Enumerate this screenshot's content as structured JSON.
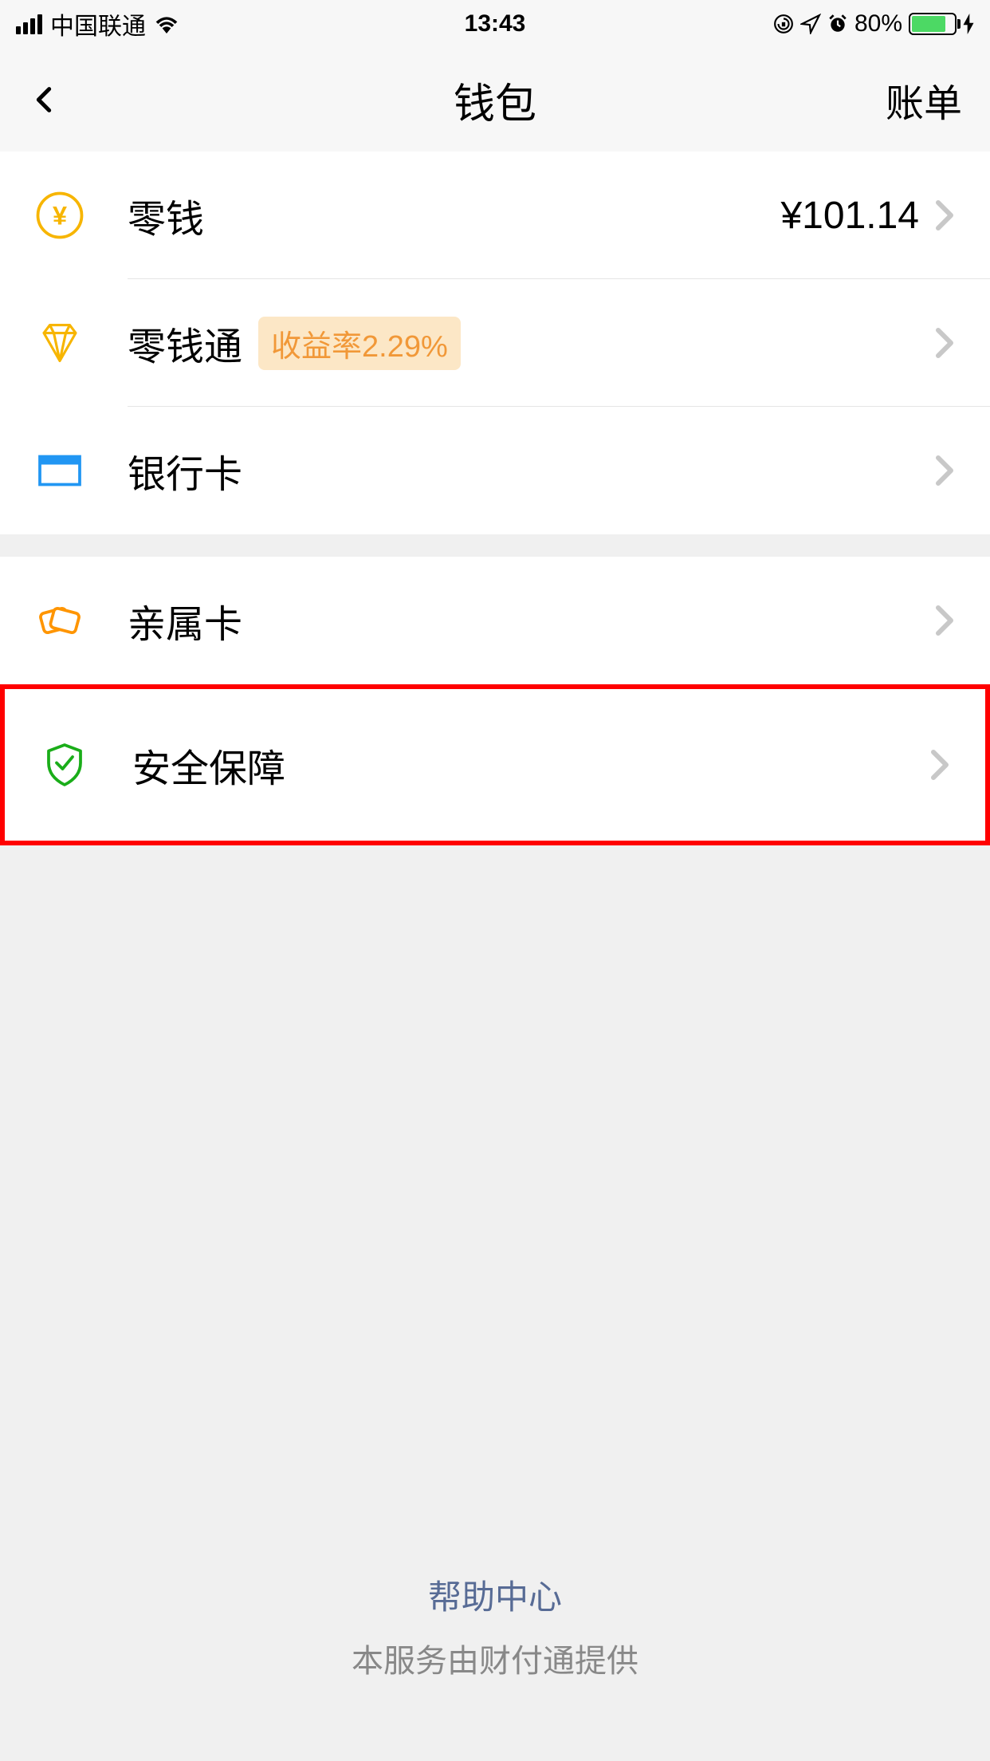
{
  "status_bar": {
    "carrier": "中国联通",
    "time": "13:43",
    "battery_percent": "80%"
  },
  "nav": {
    "title": "钱包",
    "right_action": "账单"
  },
  "items": {
    "balance": {
      "label": "零钱",
      "value": "¥101.14"
    },
    "fund": {
      "label": "零钱通",
      "badge": "收益率2.29%"
    },
    "bank_card": {
      "label": "银行卡"
    },
    "family_card": {
      "label": "亲属卡"
    },
    "security": {
      "label": "安全保障"
    }
  },
  "footer": {
    "help_link": "帮助中心",
    "provider_text": "本服务由财付通提供"
  }
}
